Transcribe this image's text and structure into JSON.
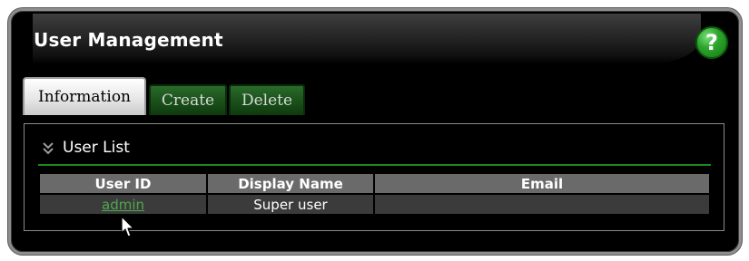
{
  "panel": {
    "title": "User Management",
    "help_icon": "question-mark-icon",
    "help_label": "?"
  },
  "tabs": [
    {
      "label": "Information",
      "active": true
    },
    {
      "label": "Create",
      "active": false
    },
    {
      "label": "Delete",
      "active": false
    }
  ],
  "user_list": {
    "header_icon": "double-chevron-down-icon",
    "title": "User List",
    "columns": [
      "User ID",
      "Display Name",
      "Email"
    ],
    "rows": [
      {
        "user_id": "admin",
        "display_name": "Super user",
        "email": ""
      }
    ]
  },
  "colors": {
    "accent_green": "#1e8a1e",
    "link_green": "#4fa84f",
    "help_button": "#2fa52f"
  },
  "cursor": "arrow-pointer-icon"
}
